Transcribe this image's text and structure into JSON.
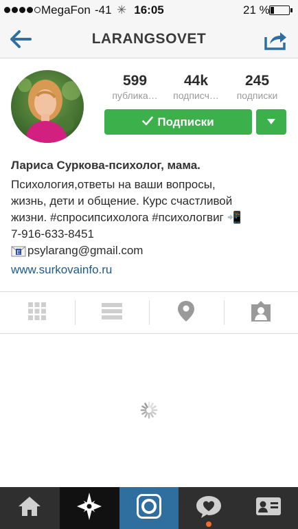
{
  "status_bar": {
    "carrier": "MegaFon",
    "signal_db": "-41",
    "time": "16:05",
    "battery_percent_label": "21 %",
    "battery_level": 0.21
  },
  "header": {
    "title": "LARANGSOVET"
  },
  "profile": {
    "stats": [
      {
        "value": "599",
        "label": "публика…"
      },
      {
        "value": "44k",
        "label": "подписч…"
      },
      {
        "value": "245",
        "label": "подписки"
      }
    ],
    "follow_label": "Подписки",
    "name": "Лариса Суркова-психолог, мама.",
    "bio_lines": "Психология,ответы на ваши вопросы,\nжизнь, дети и общение. Курс счастливой\nжизни. #спросипсихолога #психологвиг 📲\n7-916-633-8451",
    "email": "psylarang@gmail.com",
    "website": "www.surkovainfo.ru"
  },
  "view_toggles": [
    {
      "icon": "grid-icon"
    },
    {
      "icon": "list-icon"
    },
    {
      "icon": "location-pin-icon"
    },
    {
      "icon": "tagged-person-icon"
    }
  ],
  "tabbar": [
    {
      "icon": "home-icon"
    },
    {
      "icon": "explore-star-icon"
    },
    {
      "icon": "camera-icon"
    },
    {
      "icon": "activity-heart-bubble-icon",
      "has_notification": true
    },
    {
      "icon": "profile-card-icon"
    }
  ],
  "colors": {
    "accent_blue": "#2f6f9f",
    "follow_green": "#3cb04a",
    "link_blue": "#1b5a8c",
    "notification_orange": "#f26b2a"
  }
}
